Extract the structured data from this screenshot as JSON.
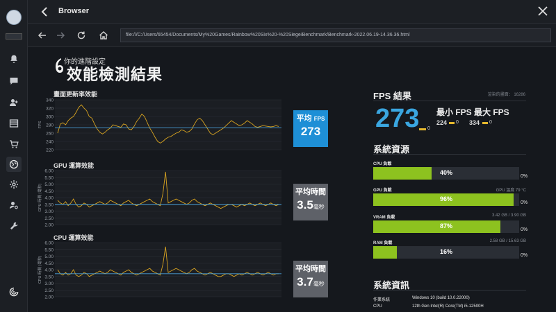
{
  "window": {
    "title": "Browser"
  },
  "url": "file:///C:/Users/65454/Documents/My%20Games/Rainbow%20Six%20-%20Siege/Benchmark/Benchmark-2022.06.19-14.36.36.html",
  "page": {
    "subtitle": "你的進階設定",
    "title": "效能檢測結果"
  },
  "fps_section": {
    "label": "畫面更新率效能",
    "yaxis_label": "FPS",
    "avg_label": "平均",
    "avg_unit": "FPS",
    "avg_value": "273",
    "yticks": [
      "340",
      "320",
      "300",
      "280",
      "260",
      "240",
      "220"
    ]
  },
  "gpu_section": {
    "label": "GPU 運算效能",
    "yaxis_label": "GPU 時間 (毫秒)",
    "avg_label": "平均時間",
    "avg_value": "3.5",
    "avg_unit": "毫秒",
    "yticks": [
      "6.00",
      "5.50",
      "5.00",
      "4.50",
      "4.00",
      "3.50",
      "3.00",
      "2.50",
      "2.00"
    ]
  },
  "cpu_section": {
    "label": "CPU 運算效能",
    "yaxis_label": "CPU 時間 (毫秒)",
    "avg_label": "平均時間",
    "avg_value": "3.7",
    "avg_unit": "毫秒",
    "yticks": [
      "6.00",
      "5.50",
      "5.00",
      "4.50",
      "4.00",
      "3.50",
      "3.00",
      "2.50",
      "2.00"
    ]
  },
  "fps_results": {
    "header": "FPS 結果",
    "frames_label": "渲染的畫面：",
    "frames_value": "16286",
    "avg": "273",
    "avg_low": "0",
    "min_label": "最小 FPS",
    "max_label": "最大 FPS",
    "min_value": "224",
    "min_low": "0",
    "max_value": "334",
    "max_low": "0"
  },
  "resources": {
    "header": "系統資源",
    "items": [
      {
        "name": "CPU 負載",
        "extra": "",
        "percent": 40,
        "pct_text": "40%",
        "zero": "0%"
      },
      {
        "name": "GPU 負載",
        "extra": "GPU 溫度 79 °C",
        "percent": 96,
        "pct_text": "96%",
        "zero": "0%"
      },
      {
        "name": "VRAM 負載",
        "extra": "3.42 GB / 3.90 GB",
        "percent": 87,
        "pct_text": "87%",
        "zero": "0%"
      },
      {
        "name": "RAM 負載",
        "extra": "2.58 GB / 15.63 GB",
        "percent": 16,
        "pct_text": "16%",
        "zero": "0%"
      }
    ]
  },
  "system_info": {
    "header": "系統資訊",
    "rows": [
      {
        "key": "作業系統",
        "value": "Windows 10 (build 10.0.22000)"
      },
      {
        "key": "CPU",
        "value": "12th Gen Intel(R) Core(TM) i5-12500H"
      }
    ]
  },
  "colors": {
    "accent_blue": "#3aa6e0",
    "bar_green": "#8dc21f",
    "series_yellow": "#d9a420",
    "avg_line": "#4aa0d8",
    "box_blue": "#1e8fd6",
    "box_gray": "#5e6168"
  },
  "chart_data": [
    {
      "type": "line",
      "title": "畫面更新率效能",
      "ylabel": "FPS",
      "ylim": [
        220,
        340
      ],
      "avg": 273,
      "series": [
        {
          "values": [
            260,
            282,
            285,
            280,
            290,
            296,
            300,
            310,
            322,
            328,
            320,
            314,
            300,
            296,
            282,
            270,
            262,
            258,
            262,
            268,
            272,
            280,
            278,
            276,
            274,
            282,
            280,
            270,
            268,
            276,
            288,
            296,
            306,
            300,
            286,
            272,
            262,
            250,
            240,
            236,
            240,
            246,
            250,
            252,
            256,
            260,
            262,
            268,
            266,
            262,
            264,
            270,
            282,
            292,
            296,
            290,
            280,
            270,
            260,
            256,
            260,
            264,
            268,
            272,
            278,
            284,
            290,
            286,
            282,
            278,
            280,
            284,
            290,
            286,
            282,
            276,
            274,
            276,
            278,
            277,
            276,
            275,
            276,
            278,
            276
          ]
        }
      ]
    },
    {
      "type": "line",
      "title": "GPU 運算效能",
      "ylabel": "GPU 時間 (毫秒)",
      "ylim": [
        2.0,
        6.0
      ],
      "avg": 3.5,
      "series": [
        {
          "values": [
            3.8,
            3.6,
            3.5,
            3.7,
            3.4,
            3.6,
            3.9,
            3.5,
            3.3,
            3.4,
            3.6,
            3.5,
            3.3,
            3.4,
            3.5,
            3.6,
            3.7,
            3.6,
            3.5,
            3.6,
            3.8,
            3.7,
            3.6,
            3.5,
            3.4,
            3.6,
            3.7,
            3.8,
            3.6,
            3.5,
            3.4,
            3.5,
            3.6,
            3.7,
            3.8,
            3.9,
            3.7,
            3.6,
            3.5,
            3.4,
            4.3,
            5.9,
            3.6,
            3.7,
            3.8,
            3.9,
            3.8,
            3.7,
            3.6,
            3.5,
            3.6,
            3.8,
            3.9,
            3.7,
            3.6,
            3.5,
            3.4,
            3.5,
            3.6,
            3.5,
            3.4,
            3.3,
            3.2,
            3.3,
            3.4,
            3.5,
            3.5,
            3.4,
            3.3,
            3.4,
            3.5,
            3.4,
            3.5,
            3.6,
            3.5,
            3.4,
            3.5,
            3.6,
            3.5,
            3.4,
            3.5,
            3.6,
            3.5,
            3.4,
            3.5
          ]
        }
      ]
    },
    {
      "type": "line",
      "title": "CPU 運算效能",
      "ylabel": "CPU 時間 (毫秒)",
      "ylim": [
        2.0,
        6.0
      ],
      "avg": 3.7,
      "series": [
        {
          "values": [
            4.0,
            3.7,
            3.6,
            3.8,
            3.6,
            3.7,
            4.0,
            3.6,
            3.5,
            3.6,
            3.8,
            3.7,
            3.5,
            3.6,
            3.7,
            3.8,
            3.9,
            3.8,
            3.7,
            3.8,
            4.0,
            3.9,
            3.8,
            3.7,
            3.6,
            3.8,
            3.9,
            4.0,
            3.8,
            3.7,
            3.6,
            3.7,
            3.8,
            3.9,
            4.0,
            4.1,
            3.9,
            3.8,
            3.7,
            3.6,
            4.4,
            5.7,
            3.8,
            3.9,
            4.0,
            4.1,
            4.0,
            3.9,
            3.8,
            3.7,
            3.8,
            4.0,
            4.1,
            3.9,
            3.8,
            3.7,
            3.6,
            3.7,
            3.8,
            3.7,
            3.6,
            3.5,
            3.5,
            3.6,
            3.7,
            3.7,
            3.6,
            3.5,
            3.6,
            3.7,
            3.6,
            3.7,
            3.8,
            3.7,
            3.6,
            3.7,
            3.8,
            3.7,
            3.6,
            3.7,
            3.8,
            3.7,
            3.6,
            3.7,
            3.7
          ]
        }
      ]
    }
  ]
}
